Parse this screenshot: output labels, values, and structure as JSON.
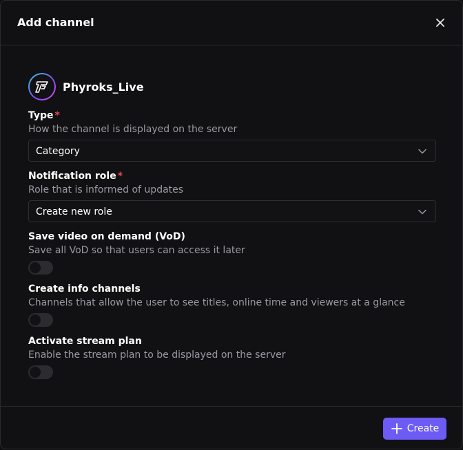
{
  "dialog": {
    "title": "Add channel",
    "close_icon": "close-icon"
  },
  "channel": {
    "name": "Phyroks_Live",
    "avatar_icon": "phyroks-logo-icon",
    "avatar_colors": [
      "#2fd4d4",
      "#7a4dff",
      "#e04de0"
    ]
  },
  "fields": {
    "type": {
      "label": "Type",
      "required_marker": "*",
      "description": "How the channel is displayed on the server",
      "value": "Category"
    },
    "notification_role": {
      "label": "Notification role",
      "required_marker": "*",
      "description": "Role that is informed of updates",
      "value": "Create new role"
    },
    "vod": {
      "label": "Save video on demand (VoD)",
      "description": "Save all VoD so that users can access it later",
      "enabled": false
    },
    "info_channels": {
      "label": "Create info channels",
      "description": "Channels that allow the user to see titles, online time and viewers at a glance",
      "enabled": false
    },
    "stream_plan": {
      "label": "Activate stream plan",
      "description": "Enable the stream plan to be displayed on the server",
      "enabled": false
    }
  },
  "footer": {
    "create_label": "Create",
    "create_icon": "plus-icon"
  },
  "colors": {
    "accent": "#6c5cf5",
    "required": "#e5484d",
    "background": "#111113",
    "muted_text": "#9a9aa2"
  }
}
